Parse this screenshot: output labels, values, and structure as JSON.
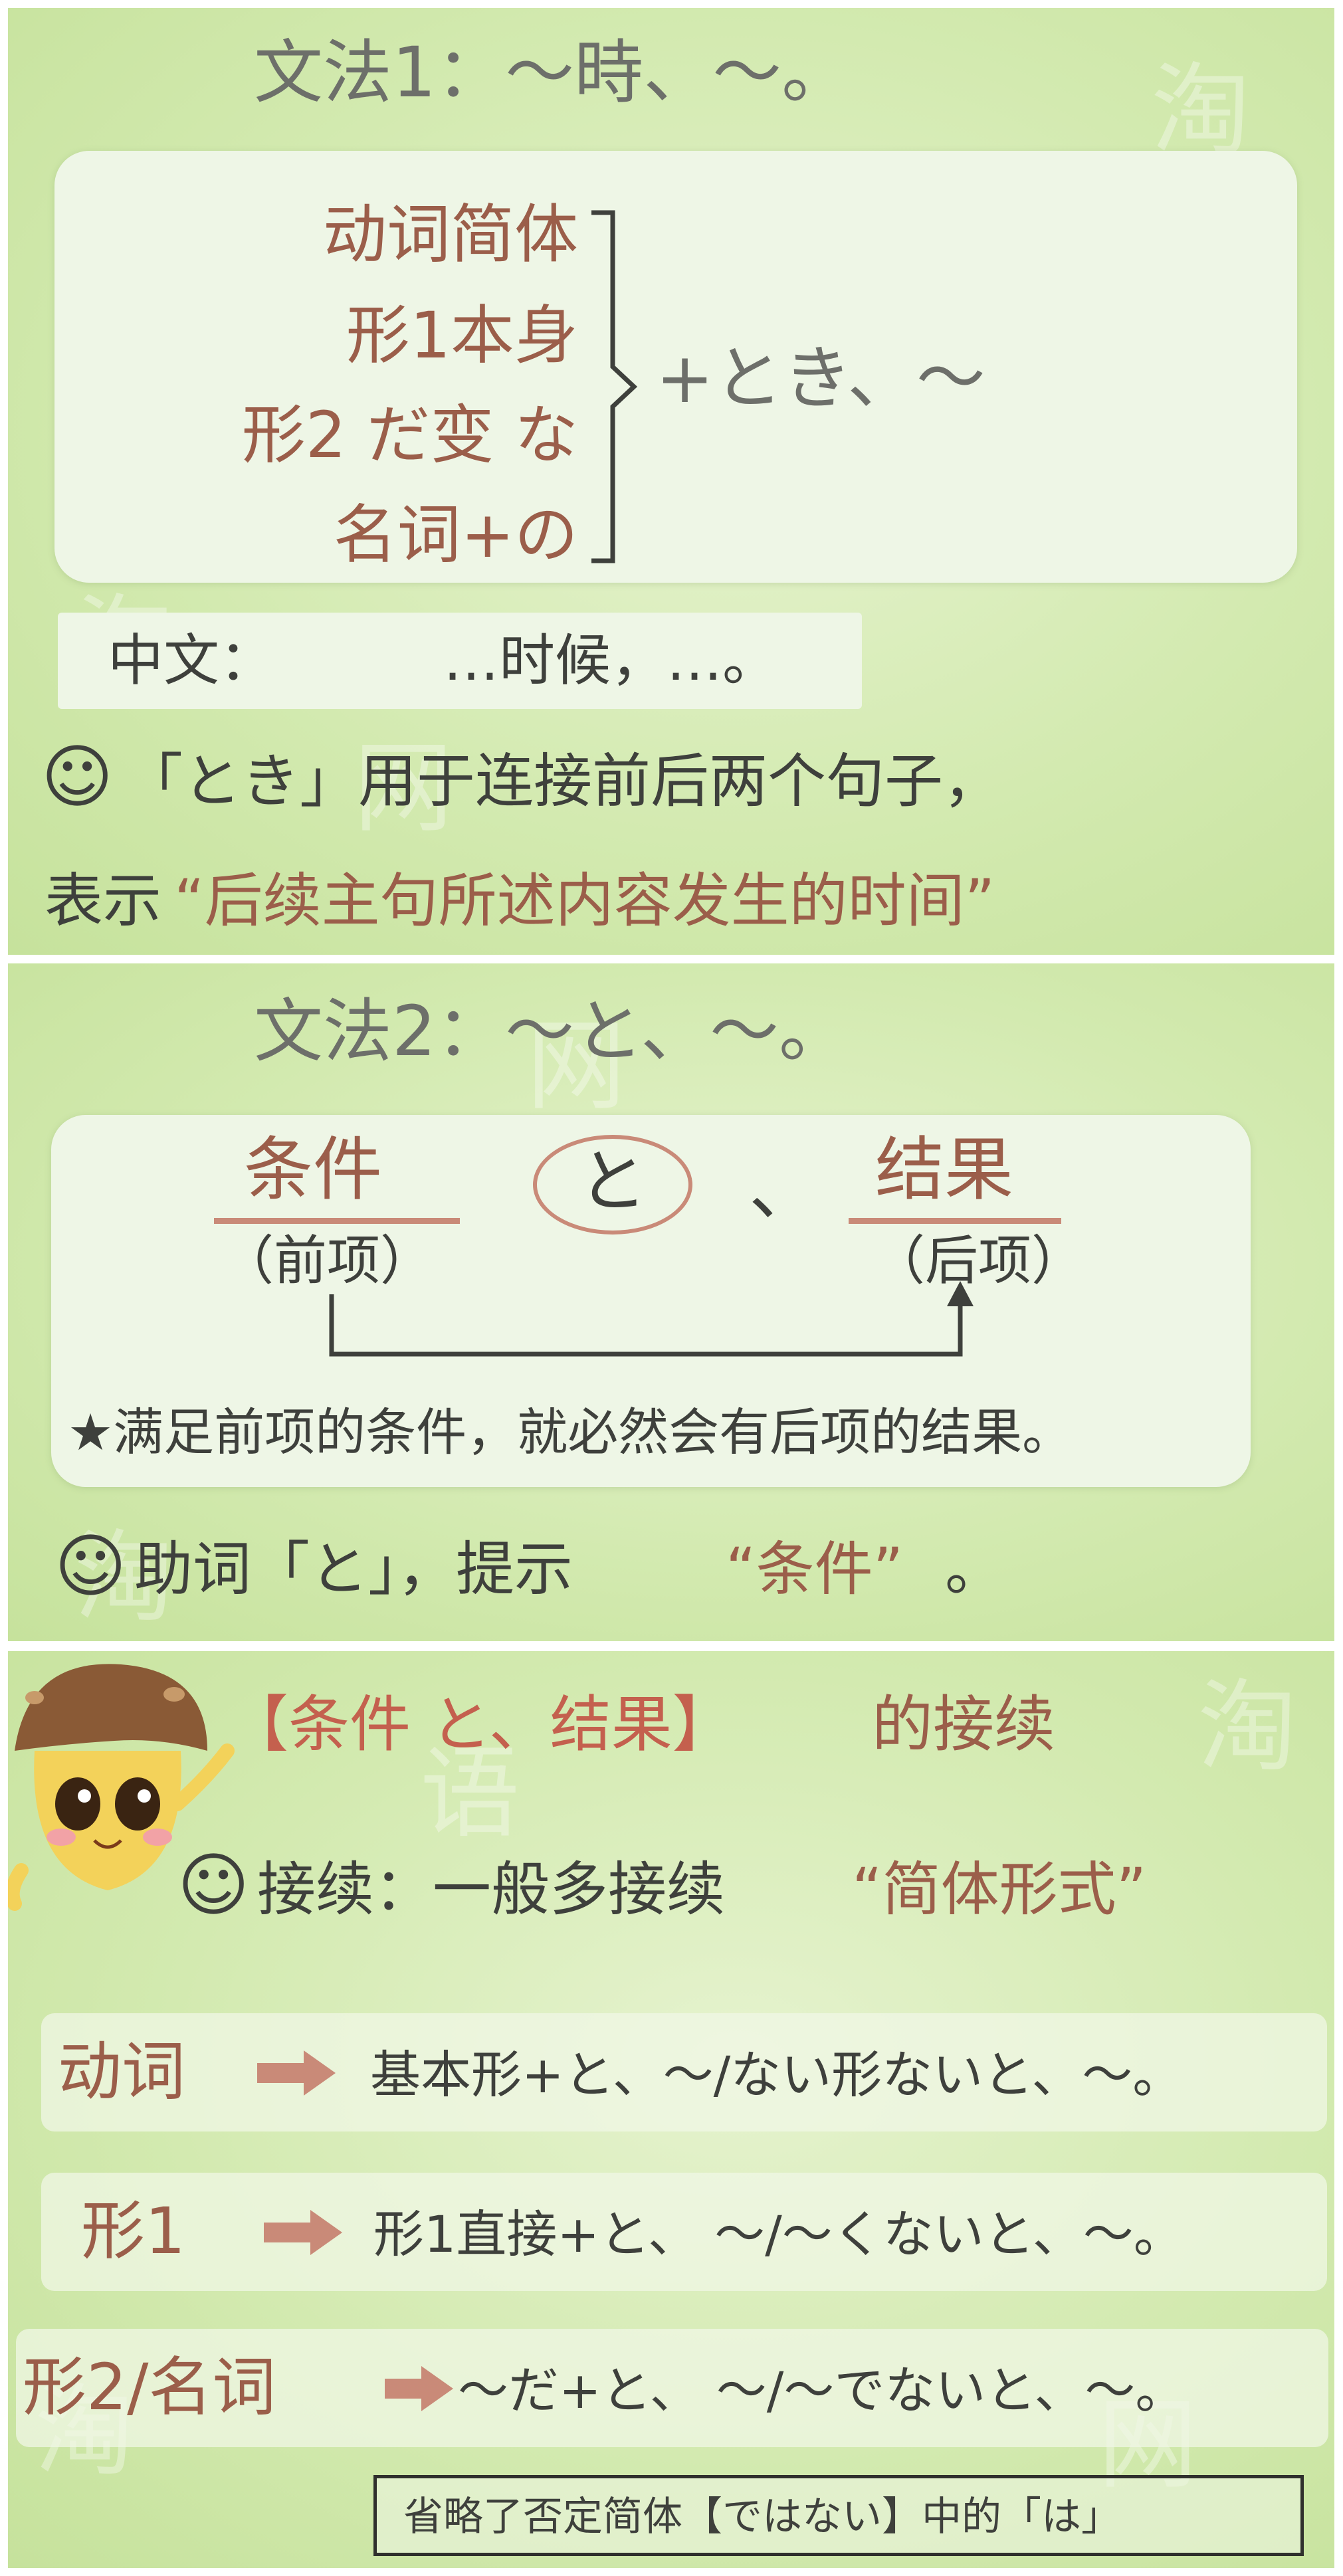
{
  "slide1": {
    "title": "文法1：～時、～。",
    "rows": [
      "动词简体",
      "形1本身",
      "形2 だ变 な",
      "名词+の"
    ],
    "suffix": "+とき、～",
    "chinese_label": "中文：",
    "chinese_value": "…时候，…。",
    "smile": "☺",
    "note1": "「とき」用于连接前后两个句子，",
    "note2_prefix": "表示",
    "note2_quote": "“后续主句所述内容发生的时间”"
  },
  "slide2": {
    "title": "文法2：～と、～。",
    "left_term": "条件",
    "left_sub": "（前项）",
    "particle": "と",
    "comma": "、",
    "right_term": "结果",
    "right_sub": "（后项）",
    "star_note": "★满足前项的条件，就必然会有后项的结果。",
    "smile": "☺",
    "note_prefix": "助词「と」，提示",
    "note_quote": "“条件”",
    "note_suffix": "。"
  },
  "slide3": {
    "title_red": "【条件 と、结果】",
    "title_rest": "的接续",
    "smile": "☺",
    "conn_prefix": "接续：一般多接续",
    "conn_quote": "“简体形式”",
    "rows": [
      {
        "label": "动词",
        "rule": "基本形+と、～/ない形ないと、～。"
      },
      {
        "label": "形1",
        "rule": "形1直接+と、 ～/～くないと、～。"
      },
      {
        "label": "形2/名词",
        "rule": "～だ+と、 ～/～でないと、～。"
      }
    ],
    "footnote": "省略了否定简体【ではない】中的「は」"
  },
  "colors": {
    "brown": "#9b5e4a",
    "gray_text": "#6d6f6a",
    "slide_green": "#d3eab0",
    "arrow": "#c98a78"
  }
}
